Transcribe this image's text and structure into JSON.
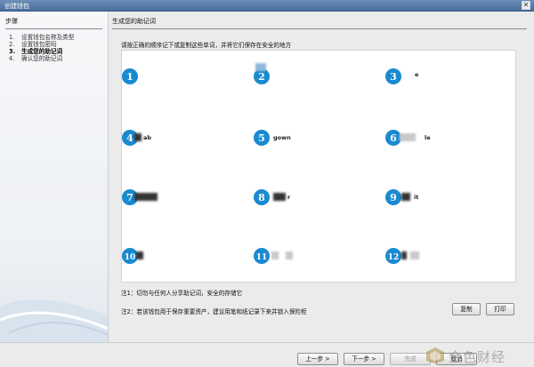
{
  "window": {
    "title": "创建钱包"
  },
  "sidebar": {
    "heading": "步骤",
    "steps": [
      {
        "num": "1.",
        "label": "设置钱包名称及类型"
      },
      {
        "num": "2.",
        "label": "设置钱包密码"
      },
      {
        "num": "3.",
        "label": "生成您的助记词"
      },
      {
        "num": "4.",
        "label": "确认您的助记词"
      }
    ]
  },
  "main": {
    "heading": "生成您的助记词",
    "instruction": "请按正确的顺序记下或复制这些单词，并将它们保存在安全的地方",
    "words": [
      {
        "num": "1",
        "text": ""
      },
      {
        "num": "2",
        "text": ""
      },
      {
        "num": "3",
        "text": "e"
      },
      {
        "num": "4",
        "text": "ab"
      },
      {
        "num": "5",
        "text": "gown"
      },
      {
        "num": "6",
        "text": "le"
      },
      {
        "num": "7",
        "text": ""
      },
      {
        "num": "8",
        "text": "r"
      },
      {
        "num": "9",
        "text": "it"
      },
      {
        "num": "10",
        "text": ""
      },
      {
        "num": "11",
        "text": ""
      },
      {
        "num": "12",
        "text": ""
      }
    ],
    "note1": "注1：切勿与任何人分享助记词，安全的存储它",
    "note2": "注2：若该钱包用于保存重要资产，建议用笔和纸记录下来并锁入保险柜",
    "copy_button": "复制",
    "print_button": "打印"
  },
  "footer": {
    "prev_button": "上一步 >",
    "next_button": "下一步 >",
    "finish_button": "完成",
    "cancel_button": "取消"
  },
  "watermark": {
    "text": "金色财经"
  },
  "colors": {
    "badge": "#1a8ad0",
    "titlebar": "#4a6f9c"
  }
}
